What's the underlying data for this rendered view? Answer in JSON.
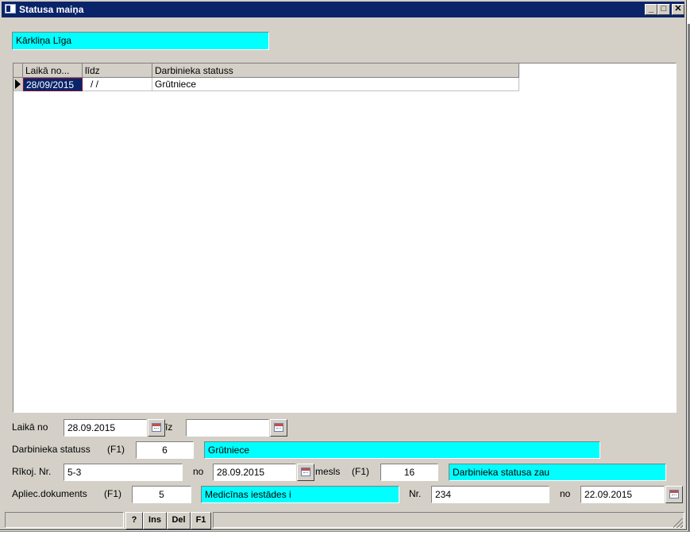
{
  "window": {
    "title": "Statusa maiņa",
    "colors": {
      "titlebar": "#0a246a",
      "face": "#d4d0c8",
      "highlight_field": "#00ffff"
    }
  },
  "employee_name": "Kārkliņa Līga",
  "grid": {
    "columns": [
      "Laikā no...",
      "līdz",
      "Darbinieka statuss"
    ],
    "rows": [
      {
        "from": "28/09/2015",
        "to": " / /",
        "status": "Grūtniece"
      }
    ]
  },
  "form": {
    "period_from_label": "Laikā no",
    "period_from_value": "28.09.2015",
    "period_to_label": "īz",
    "period_to_value": "",
    "status_label": "Darbinieka statuss",
    "status_key": "(F1)",
    "status_code": "6",
    "status_name": "Grūtniece",
    "order_label": "Rīkoj. Nr.",
    "order_value": "5-3",
    "order_date_label": "no",
    "order_date_value": "28.09.2015",
    "reason_label": "mesls",
    "reason_key": "(F1)",
    "reason_code": "16",
    "reason_name": "Darbinieka statusa zau",
    "doc_label": "Apliec.dokuments",
    "doc_key": "(F1)",
    "doc_code": "5",
    "doc_name": "Medicīnas iestādes i",
    "doc_nr_label": "Nr.",
    "doc_nr_value": "234",
    "doc_date_label": "no",
    "doc_date_value": "22.09.2015"
  },
  "statusbar": {
    "buttons": [
      "?",
      "Ins",
      "Del",
      "F1"
    ]
  },
  "icons": [
    "window-icon",
    "minimize-icon",
    "maximize-icon",
    "close-icon",
    "calendar-icon",
    "row-pointer-icon",
    "resize-grip-icon"
  ]
}
